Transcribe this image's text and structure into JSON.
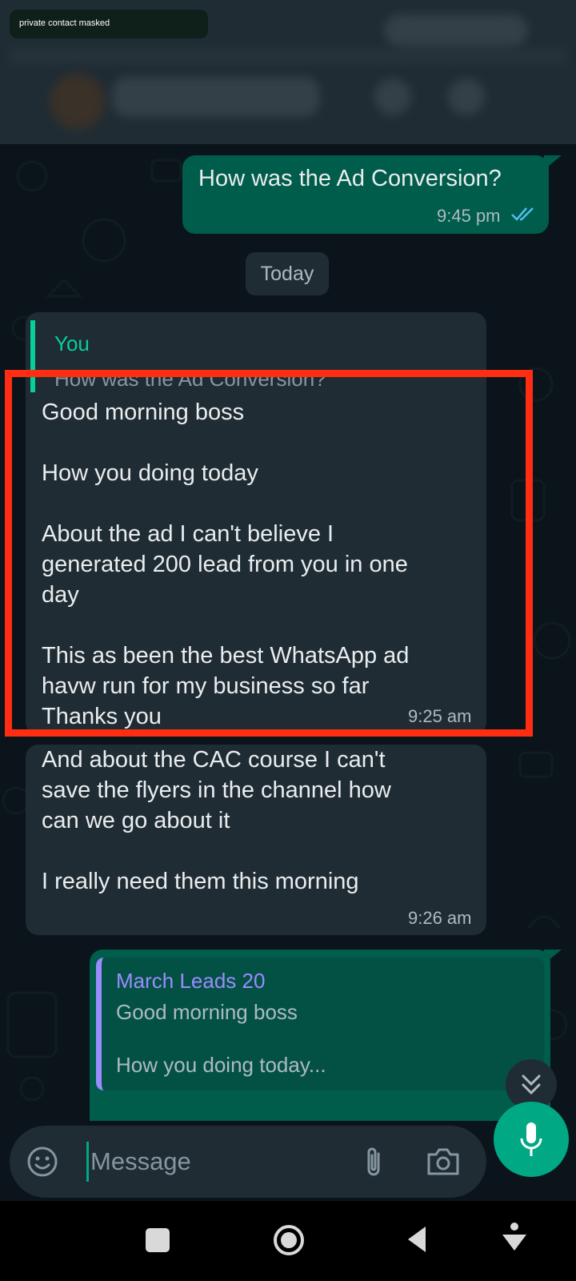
{
  "header": {
    "masked_label": "private contact masked"
  },
  "chat": {
    "date_separator": "Today",
    "messages": [
      {
        "id": "out-1",
        "direction": "outgoing",
        "text": "How was the Ad Conversion?",
        "time": "9:45 pm",
        "status": "read"
      },
      {
        "id": "in-1",
        "direction": "incoming",
        "quote": {
          "author": "You",
          "text": "How was the Ad Conversion?"
        },
        "text": "Good morning boss\n\nHow you doing today\n\nAbout the ad I can't believe I\ngenerated 200 lead from you in one\nday\n\nThis as been the best WhatsApp ad\nhavw run for my business so far\nThanks you",
        "time": "9:25 am"
      },
      {
        "id": "in-2",
        "direction": "incoming",
        "text": "And about the CAC course I can't\nsave the flyers in the channel how\ncan we go about it\n\nI really need them this morning",
        "time": "9:26 am"
      },
      {
        "id": "out-2",
        "direction": "outgoing",
        "quote": {
          "author": "March Leads 20",
          "text": "Good morning boss\n\nHow you doing today..."
        }
      }
    ]
  },
  "input": {
    "placeholder": "Message"
  },
  "icons": {
    "emoji": "emoji-icon",
    "attach": "paperclip-icon",
    "camera": "camera-icon",
    "mic": "mic-icon",
    "scroll_down": "double-chevron-down-icon",
    "read_receipt": "double-check-icon"
  },
  "colors": {
    "outgoing_bubble": "#005c4b",
    "incoming_bubble": "#202c33",
    "accent": "#00a884",
    "highlight_border": "#ff2d12",
    "quote_you": "#06cf9c",
    "quote_other": "#9b8cfd"
  }
}
